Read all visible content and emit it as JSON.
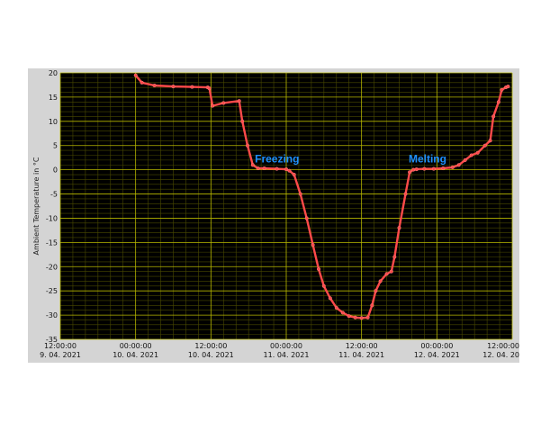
{
  "chart_data": {
    "type": "line",
    "title": "",
    "xlabel": "",
    "ylabel": "Ambient Temperature in °C",
    "ylim": [
      -35,
      20
    ],
    "yticks": [
      20,
      15,
      10,
      5,
      0,
      -5,
      -10,
      -15,
      -20,
      -25,
      -30,
      -35
    ],
    "xticks": [
      {
        "time": "12:00:00",
        "date": "9. 04. 2021"
      },
      {
        "time": "00:00:00",
        "date": "10. 04. 2021"
      },
      {
        "time": "12:00:00",
        "date": "10. 04. 2021"
      },
      {
        "time": "00:00:00",
        "date": "11. 04. 2021"
      },
      {
        "time": "12:00:00",
        "date": "11. 04. 2021"
      },
      {
        "time": "00:00:00",
        "date": "12. 04. 2021"
      },
      {
        "time": "12:00:00",
        "date": "12. 04. 20"
      }
    ],
    "grid": true,
    "colors": {
      "background": "#000000",
      "major_grid": "#b8b800",
      "minor_grid": "#4a4a00",
      "series": "#ff4a4a",
      "annotation": "#1e90ff"
    },
    "series": [
      {
        "x": [
          "2021-04-10 00:00",
          "2021-04-10 01:00",
          "2021-04-10 03:00",
          "2021-04-10 06:00",
          "2021-04-10 09:00",
          "2021-04-10 11:30",
          "2021-04-10 11:45",
          "2021-04-10 12:15",
          "2021-04-10 14:00",
          "2021-04-10 16:30",
          "2021-04-10 17:00",
          "2021-04-10 17:50",
          "2021-04-10 18:40",
          "2021-04-10 19:30",
          "2021-04-10 20:30",
          "2021-04-10 22:30",
          "2021-04-11 00:00",
          "2021-04-11 00:30",
          "2021-04-11 01:15",
          "2021-04-11 02:15",
          "2021-04-11 03:15",
          "2021-04-11 04:15",
          "2021-04-11 05:10",
          "2021-04-11 06:00",
          "2021-04-11 07:00",
          "2021-04-11 08:00",
          "2021-04-11 09:00",
          "2021-04-11 10:00",
          "2021-04-11 11:00",
          "2021-04-11 12:00",
          "2021-04-11 13:00",
          "2021-04-11 13:40",
          "2021-04-11 14:15",
          "2021-04-11 15:00",
          "2021-04-11 16:00",
          "2021-04-11 16:45",
          "2021-04-11 17:15",
          "2021-04-11 18:00",
          "2021-04-11 19:00",
          "2021-04-11 19:40",
          "2021-04-11 20:15",
          "2021-04-11 20:45",
          "2021-04-11 22:00",
          "2021-04-11 23:30",
          "2021-04-12 01:00",
          "2021-04-12 02:30",
          "2021-04-12 03:30",
          "2021-04-12 04:30",
          "2021-04-12 05:30",
          "2021-04-12 06:30",
          "2021-04-12 07:40",
          "2021-04-12 08:30",
          "2021-04-12 09:00",
          "2021-04-12 09:50",
          "2021-04-12 10:20",
          "2021-04-12 11:00",
          "2021-04-12 11:20"
        ],
        "values": [
          19.5,
          18.0,
          17.4,
          17.2,
          17.1,
          17.0,
          16.8,
          13.2,
          13.8,
          14.2,
          10.0,
          5.0,
          1.0,
          0.3,
          0.3,
          0.2,
          0.1,
          -0.2,
          -1.0,
          -5.0,
          -10.0,
          -15.5,
          -20.5,
          -24.0,
          -26.5,
          -28.5,
          -29.5,
          -30.2,
          -30.5,
          -30.6,
          -30.5,
          -28.0,
          -25.0,
          -23.0,
          -21.5,
          -21.0,
          -18.0,
          -12.0,
          -5.0,
          -0.5,
          0.0,
          0.1,
          0.2,
          0.2,
          0.3,
          0.5,
          1.0,
          2.0,
          3.0,
          3.5,
          5.0,
          6.0,
          11.0,
          14.0,
          16.5,
          17.0,
          17.2
        ]
      }
    ],
    "annotations": [
      {
        "text": "Freezing",
        "x": "2021-04-10 19:00",
        "y": 1.5
      },
      {
        "text": "Melting",
        "x": "2021-04-11 19:30",
        "y": 1.5
      }
    ]
  }
}
